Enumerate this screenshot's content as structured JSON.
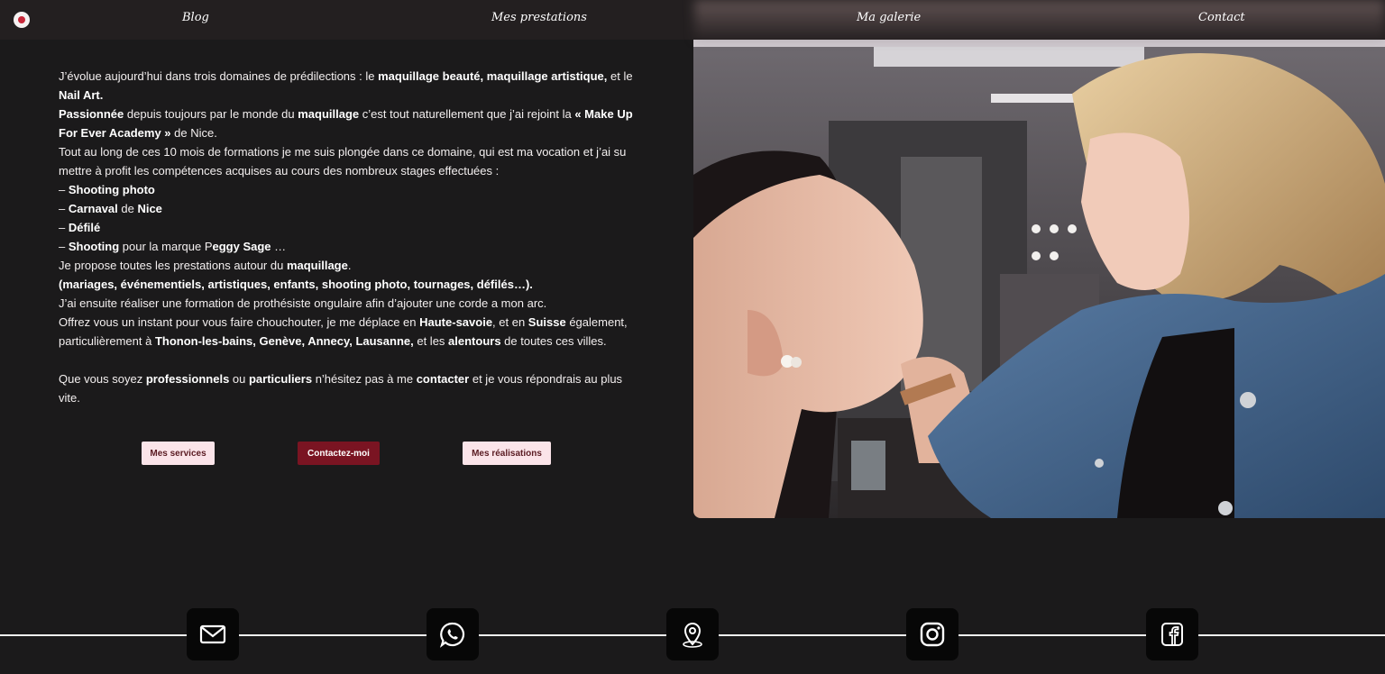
{
  "nav": {
    "items": [
      {
        "label": "Blog"
      },
      {
        "label": "Mes prestations"
      },
      {
        "label": "Ma galerie"
      },
      {
        "label": "Contact"
      }
    ],
    "logo_icon": "brand-logo-icon"
  },
  "about": {
    "lines": [
      [
        {
          "t": "J’évolue aujourd’hui dans trois domaines de prédilections : le "
        },
        {
          "t": "maquillage beauté, maquillage artistique,",
          "b": true
        },
        {
          "t": " et le"
        }
      ],
      [
        {
          "t": "Nail Art.",
          "b": true
        }
      ],
      [
        {
          "t": "Passionnée",
          "b": true
        },
        {
          "t": " depuis toujours par le monde du "
        },
        {
          "t": "maquillage",
          "b": true
        },
        {
          "t": " c’est tout naturellement que j’ai rejoint la "
        },
        {
          "t": "« Make Up",
          "b": true
        }
      ],
      [
        {
          "t": "For Ever Academy »",
          "b": true
        },
        {
          "t": " de Nice."
        }
      ],
      [
        {
          "t": "Tout au long de ces 10 mois de formations je me suis plongée dans ce domaine, qui est ma vocation et j’ai su"
        }
      ],
      [
        {
          "t": "mettre à profit les compétences acquises au cours des nombreux stages effectuées :"
        }
      ],
      [
        {
          "t": "– "
        },
        {
          "t": "Shooting photo",
          "b": true
        }
      ],
      [
        {
          "t": "– "
        },
        {
          "t": "Carnaval",
          "b": true
        },
        {
          "t": " de "
        },
        {
          "t": "Nice",
          "b": true
        }
      ],
      [
        {
          "t": "– "
        },
        {
          "t": "Défilé",
          "b": true
        }
      ],
      [
        {
          "t": "– "
        },
        {
          "t": "Shooting",
          "b": true
        },
        {
          "t": " pour la marque P"
        },
        {
          "t": "eggy Sage",
          "b": true
        },
        {
          "t": " …"
        }
      ],
      [
        {
          "t": "Je propose toutes les prestations autour du "
        },
        {
          "t": "maquillage",
          "b": true
        },
        {
          "t": "."
        }
      ],
      [
        {
          "t": "(mariages, événementiels, artistiques, enfants, shooting photo, tournages, défilés…).",
          "b": true
        }
      ],
      [
        {
          "t": "J’ai ensuite réaliser une formation de prothésiste ongulaire afin d’ajouter une corde a mon arc."
        }
      ],
      [
        {
          "t": "Offrez vous un instant pour vous faire chouchouter, je me déplace en "
        },
        {
          "t": "Haute-savoie",
          "b": true
        },
        {
          "t": ", et en "
        },
        {
          "t": "Suisse",
          "b": true
        },
        {
          "t": " également,"
        }
      ],
      [
        {
          "t": "particulièrement à "
        },
        {
          "t": "Thonon-les-bains, Genève, Annecy, Lausanne,",
          "b": true
        },
        {
          "t": " et les "
        },
        {
          "t": "alentours",
          "b": true
        },
        {
          "t": " de toutes ces villes."
        }
      ],
      [],
      [
        {
          "t": "Que vous soyez "
        },
        {
          "t": "professionnels",
          "b": true
        },
        {
          "t": " ou "
        },
        {
          "t": "particuliers",
          "b": true
        },
        {
          "t": " n’hésitez pas à me "
        },
        {
          "t": "contacter",
          "b": true
        },
        {
          "t": " et je vous répondrais au plus vite."
        }
      ]
    ]
  },
  "buttons": {
    "services": "Mes services",
    "contact": "Contactez-moi",
    "realisations": "Mes réalisations"
  },
  "photo": {
    "subject": "makeup-artist-applying-makeup-photo"
  },
  "footer": {
    "socials": [
      {
        "icon": "mail-icon"
      },
      {
        "icon": "whatsapp-icon"
      },
      {
        "icon": "location-pin-icon"
      },
      {
        "icon": "instagram-icon"
      },
      {
        "icon": "facebook-icon"
      }
    ]
  },
  "colors": {
    "background": "#1b1a1b",
    "nav": "#231f20",
    "accent_dark": "#7a1422",
    "accent_light": "#fbe4e9"
  }
}
